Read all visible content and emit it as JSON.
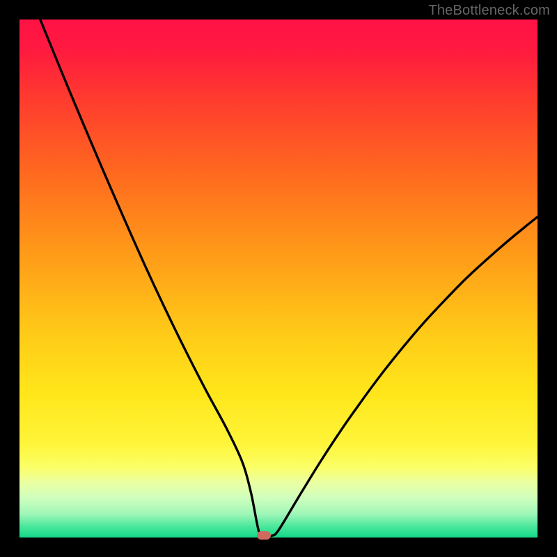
{
  "watermark": "TheBottleneck.com",
  "colors": {
    "frame": "#000000",
    "curve": "#000000",
    "marker": "#cf6a60",
    "gradient_stops": [
      {
        "offset": 0.0,
        "color": "#ff1245"
      },
      {
        "offset": 0.06,
        "color": "#ff1a3f"
      },
      {
        "offset": 0.15,
        "color": "#ff3a2f"
      },
      {
        "offset": 0.3,
        "color": "#ff6a1f"
      },
      {
        "offset": 0.45,
        "color": "#ff9a18"
      },
      {
        "offset": 0.6,
        "color": "#ffc918"
      },
      {
        "offset": 0.72,
        "color": "#ffe61a"
      },
      {
        "offset": 0.82,
        "color": "#fff53a"
      },
      {
        "offset": 0.865,
        "color": "#fbff68"
      },
      {
        "offset": 0.895,
        "color": "#eaffa4"
      },
      {
        "offset": 0.925,
        "color": "#ceffbe"
      },
      {
        "offset": 0.955,
        "color": "#9ef6b7"
      },
      {
        "offset": 0.98,
        "color": "#46e69a"
      },
      {
        "offset": 1.0,
        "color": "#14d989"
      }
    ]
  },
  "chart_data": {
    "type": "line",
    "title": "",
    "xlabel": "",
    "ylabel": "",
    "xrange": [
      0,
      100
    ],
    "yrange": [
      0,
      100
    ],
    "grid": false,
    "legend": false,
    "curve_description": "V-shaped curve; steep drop from top-left, minimum near x≈46 y≈0, shallower rise toward right edge reaching ~63 at x=100",
    "series": [
      {
        "name": "curve",
        "x": [
          4,
          8,
          12,
          16,
          20,
          24,
          28,
          32,
          36,
          40,
          43,
          44.7,
          46.2,
          47.2,
          48.7,
          50,
          54,
          58,
          62,
          66,
          70,
          74,
          78,
          82,
          86,
          90,
          94,
          98,
          100
        ],
        "y": [
          100,
          90.2,
          80.6,
          71.2,
          62.0,
          53.0,
          44.4,
          36.2,
          28.4,
          21.0,
          14.6,
          8.6,
          1.2,
          0.35,
          0.35,
          1.4,
          8.0,
          14.5,
          20.6,
          26.3,
          31.7,
          36.7,
          41.4,
          45.7,
          49.8,
          53.5,
          57.0,
          60.3,
          61.9
        ]
      }
    ],
    "flat_bottom": {
      "x_start": 43.5,
      "x_end": 48.3,
      "y": 0.35
    },
    "marker": {
      "x": 47.2,
      "y": 0.35
    }
  }
}
